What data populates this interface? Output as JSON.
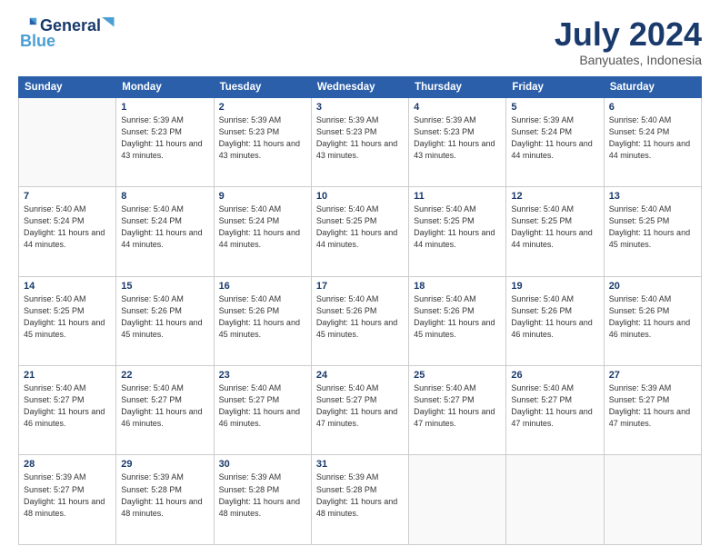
{
  "header": {
    "logo_line1": "General",
    "logo_line2": "Blue",
    "month": "July 2024",
    "location": "Banyuates, Indonesia"
  },
  "days_of_week": [
    "Sunday",
    "Monday",
    "Tuesday",
    "Wednesday",
    "Thursday",
    "Friday",
    "Saturday"
  ],
  "weeks": [
    [
      {
        "day": "",
        "sunrise": "",
        "sunset": "",
        "daylight": ""
      },
      {
        "day": "1",
        "sunrise": "Sunrise: 5:39 AM",
        "sunset": "Sunset: 5:23 PM",
        "daylight": "Daylight: 11 hours and 43 minutes."
      },
      {
        "day": "2",
        "sunrise": "Sunrise: 5:39 AM",
        "sunset": "Sunset: 5:23 PM",
        "daylight": "Daylight: 11 hours and 43 minutes."
      },
      {
        "day": "3",
        "sunrise": "Sunrise: 5:39 AM",
        "sunset": "Sunset: 5:23 PM",
        "daylight": "Daylight: 11 hours and 43 minutes."
      },
      {
        "day": "4",
        "sunrise": "Sunrise: 5:39 AM",
        "sunset": "Sunset: 5:23 PM",
        "daylight": "Daylight: 11 hours and 43 minutes."
      },
      {
        "day": "5",
        "sunrise": "Sunrise: 5:39 AM",
        "sunset": "Sunset: 5:24 PM",
        "daylight": "Daylight: 11 hours and 44 minutes."
      },
      {
        "day": "6",
        "sunrise": "Sunrise: 5:40 AM",
        "sunset": "Sunset: 5:24 PM",
        "daylight": "Daylight: 11 hours and 44 minutes."
      }
    ],
    [
      {
        "day": "7",
        "sunrise": "Sunrise: 5:40 AM",
        "sunset": "Sunset: 5:24 PM",
        "daylight": "Daylight: 11 hours and 44 minutes."
      },
      {
        "day": "8",
        "sunrise": "Sunrise: 5:40 AM",
        "sunset": "Sunset: 5:24 PM",
        "daylight": "Daylight: 11 hours and 44 minutes."
      },
      {
        "day": "9",
        "sunrise": "Sunrise: 5:40 AM",
        "sunset": "Sunset: 5:24 PM",
        "daylight": "Daylight: 11 hours and 44 minutes."
      },
      {
        "day": "10",
        "sunrise": "Sunrise: 5:40 AM",
        "sunset": "Sunset: 5:25 PM",
        "daylight": "Daylight: 11 hours and 44 minutes."
      },
      {
        "day": "11",
        "sunrise": "Sunrise: 5:40 AM",
        "sunset": "Sunset: 5:25 PM",
        "daylight": "Daylight: 11 hours and 44 minutes."
      },
      {
        "day": "12",
        "sunrise": "Sunrise: 5:40 AM",
        "sunset": "Sunset: 5:25 PM",
        "daylight": "Daylight: 11 hours and 44 minutes."
      },
      {
        "day": "13",
        "sunrise": "Sunrise: 5:40 AM",
        "sunset": "Sunset: 5:25 PM",
        "daylight": "Daylight: 11 hours and 45 minutes."
      }
    ],
    [
      {
        "day": "14",
        "sunrise": "Sunrise: 5:40 AM",
        "sunset": "Sunset: 5:25 PM",
        "daylight": "Daylight: 11 hours and 45 minutes."
      },
      {
        "day": "15",
        "sunrise": "Sunrise: 5:40 AM",
        "sunset": "Sunset: 5:26 PM",
        "daylight": "Daylight: 11 hours and 45 minutes."
      },
      {
        "day": "16",
        "sunrise": "Sunrise: 5:40 AM",
        "sunset": "Sunset: 5:26 PM",
        "daylight": "Daylight: 11 hours and 45 minutes."
      },
      {
        "day": "17",
        "sunrise": "Sunrise: 5:40 AM",
        "sunset": "Sunset: 5:26 PM",
        "daylight": "Daylight: 11 hours and 45 minutes."
      },
      {
        "day": "18",
        "sunrise": "Sunrise: 5:40 AM",
        "sunset": "Sunset: 5:26 PM",
        "daylight": "Daylight: 11 hours and 45 minutes."
      },
      {
        "day": "19",
        "sunrise": "Sunrise: 5:40 AM",
        "sunset": "Sunset: 5:26 PM",
        "daylight": "Daylight: 11 hours and 46 minutes."
      },
      {
        "day": "20",
        "sunrise": "Sunrise: 5:40 AM",
        "sunset": "Sunset: 5:26 PM",
        "daylight": "Daylight: 11 hours and 46 minutes."
      }
    ],
    [
      {
        "day": "21",
        "sunrise": "Sunrise: 5:40 AM",
        "sunset": "Sunset: 5:27 PM",
        "daylight": "Daylight: 11 hours and 46 minutes."
      },
      {
        "day": "22",
        "sunrise": "Sunrise: 5:40 AM",
        "sunset": "Sunset: 5:27 PM",
        "daylight": "Daylight: 11 hours and 46 minutes."
      },
      {
        "day": "23",
        "sunrise": "Sunrise: 5:40 AM",
        "sunset": "Sunset: 5:27 PM",
        "daylight": "Daylight: 11 hours and 46 minutes."
      },
      {
        "day": "24",
        "sunrise": "Sunrise: 5:40 AM",
        "sunset": "Sunset: 5:27 PM",
        "daylight": "Daylight: 11 hours and 47 minutes."
      },
      {
        "day": "25",
        "sunrise": "Sunrise: 5:40 AM",
        "sunset": "Sunset: 5:27 PM",
        "daylight": "Daylight: 11 hours and 47 minutes."
      },
      {
        "day": "26",
        "sunrise": "Sunrise: 5:40 AM",
        "sunset": "Sunset: 5:27 PM",
        "daylight": "Daylight: 11 hours and 47 minutes."
      },
      {
        "day": "27",
        "sunrise": "Sunrise: 5:39 AM",
        "sunset": "Sunset: 5:27 PM",
        "daylight": "Daylight: 11 hours and 47 minutes."
      }
    ],
    [
      {
        "day": "28",
        "sunrise": "Sunrise: 5:39 AM",
        "sunset": "Sunset: 5:27 PM",
        "daylight": "Daylight: 11 hours and 48 minutes."
      },
      {
        "day": "29",
        "sunrise": "Sunrise: 5:39 AM",
        "sunset": "Sunset: 5:28 PM",
        "daylight": "Daylight: 11 hours and 48 minutes."
      },
      {
        "day": "30",
        "sunrise": "Sunrise: 5:39 AM",
        "sunset": "Sunset: 5:28 PM",
        "daylight": "Daylight: 11 hours and 48 minutes."
      },
      {
        "day": "31",
        "sunrise": "Sunrise: 5:39 AM",
        "sunset": "Sunset: 5:28 PM",
        "daylight": "Daylight: 11 hours and 48 minutes."
      },
      {
        "day": "",
        "sunrise": "",
        "sunset": "",
        "daylight": ""
      },
      {
        "day": "",
        "sunrise": "",
        "sunset": "",
        "daylight": ""
      },
      {
        "day": "",
        "sunrise": "",
        "sunset": "",
        "daylight": ""
      }
    ]
  ]
}
